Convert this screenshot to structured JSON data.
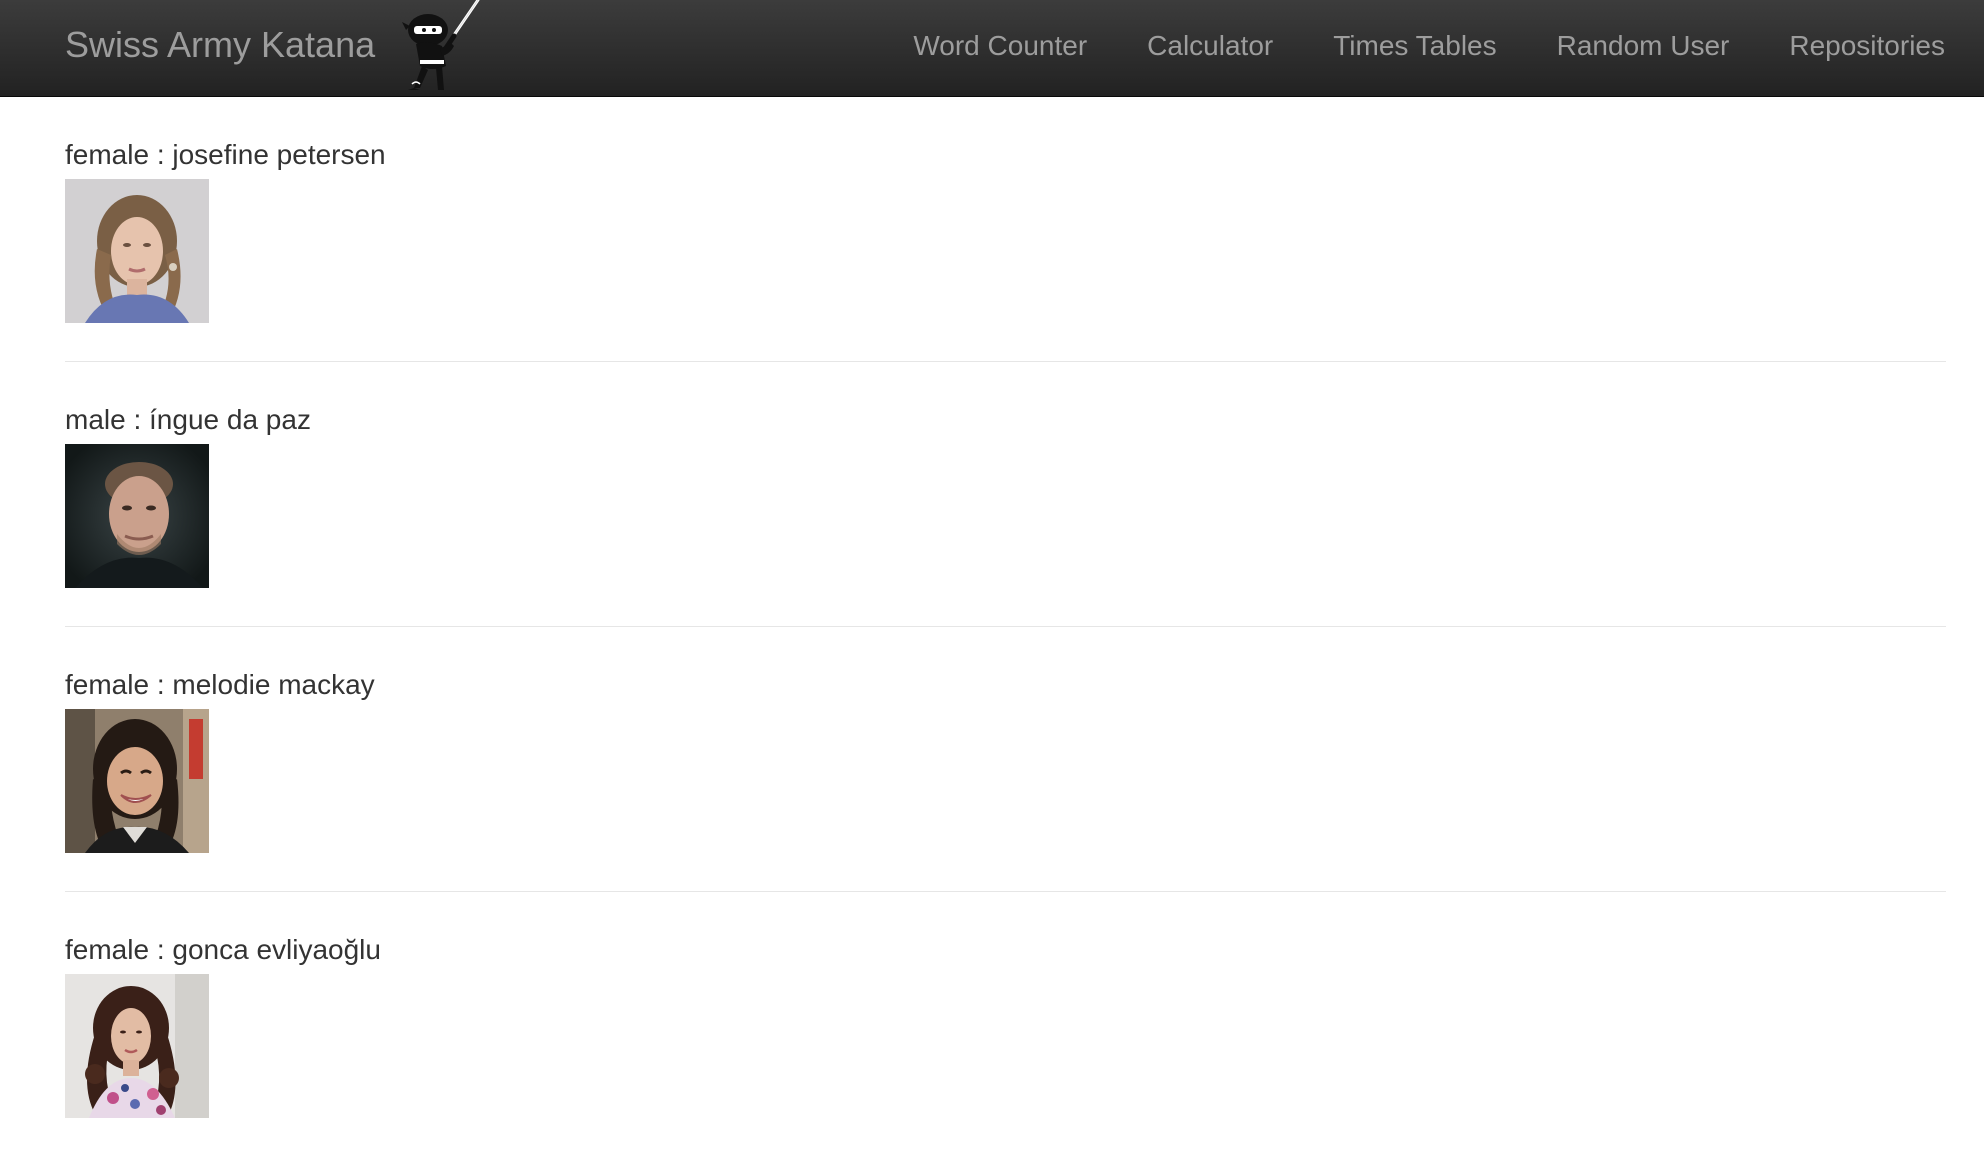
{
  "brand": {
    "title": "Swiss Army Katana",
    "logo_icon": "ninja-katana-icon"
  },
  "nav": {
    "items": [
      {
        "label": "Word Counter"
      },
      {
        "label": "Calculator"
      },
      {
        "label": "Times Tables"
      },
      {
        "label": "Random User"
      },
      {
        "label": "Repositories"
      }
    ]
  },
  "users": [
    {
      "gender": "female",
      "name": "josefine petersen",
      "heading": "female : josefine petersen"
    },
    {
      "gender": "male",
      "name": "íngue da paz",
      "heading": "male : íngue da paz"
    },
    {
      "gender": "female",
      "name": "melodie mackay",
      "heading": "female : melodie mackay"
    },
    {
      "gender": "female",
      "name": "gonca evliyaoğlu",
      "heading": "female : gonca evliyaoğlu"
    }
  ],
  "colors": {
    "navbar_bg": "#222222",
    "nav_text": "#9d9d9d",
    "body_text": "#333333",
    "divider": "#e6e6e6"
  }
}
